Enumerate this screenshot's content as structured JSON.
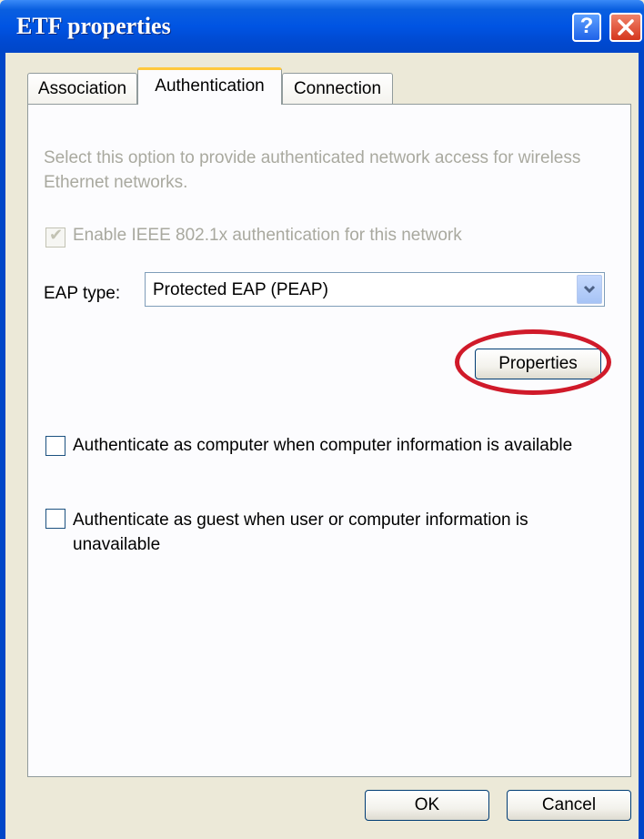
{
  "window": {
    "title": "ETF properties",
    "help_label": "?",
    "close_label": "✕"
  },
  "tabs": [
    {
      "label": "Association",
      "active": false
    },
    {
      "label": "Authentication",
      "active": true
    },
    {
      "label": "Connection",
      "active": false
    }
  ],
  "authentication": {
    "description": "Select this option to provide authenticated network access for wireless Ethernet networks.",
    "enable_8021x": {
      "label": "Enable IEEE 802.1x authentication for this network",
      "checked": true,
      "disabled": true
    },
    "eap_type": {
      "label": "EAP type:",
      "value": "Protected EAP (PEAP)"
    },
    "properties_label": "Properties",
    "auth_as_computer": {
      "label": "Authenticate as computer when computer information is available",
      "checked": false
    },
    "auth_as_guest": {
      "label": "Authenticate as guest when user or computer information is unavailable",
      "checked": false
    }
  },
  "footer": {
    "ok_label": "OK",
    "cancel_label": "Cancel"
  },
  "colors": {
    "title_bar": "#0054e3",
    "highlight_ring": "#d01a2a",
    "disabled_text": "#a9a99f"
  }
}
